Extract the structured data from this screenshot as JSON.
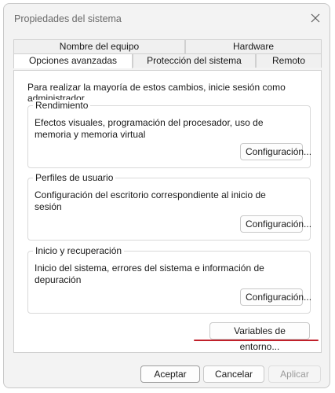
{
  "window": {
    "title": "Propiedades del sistema"
  },
  "tabs": {
    "back_row": [
      "Nombre del equipo",
      "Hardware"
    ],
    "front_row": [
      "Opciones avanzadas",
      "Protección del sistema",
      "Remoto"
    ],
    "active": "Opciones avanzadas"
  },
  "panel": {
    "note": "Para realizar la mayoría de estos cambios, inicie sesión como administrador.",
    "groups": [
      {
        "title": "Rendimiento",
        "description": "Efectos visuales, programación del procesador, uso de memoria y memoria virtual",
        "button": "Configuración..."
      },
      {
        "title": "Perfiles de usuario",
        "description": "Configuración del escritorio correspondiente al inicio de sesión",
        "button": "Configuración..."
      },
      {
        "title": "Inicio y recuperación",
        "description": "Inicio del sistema, errores del sistema e información de depuración",
        "button": "Configuración..."
      }
    ],
    "env_button": "Variables de entorno..."
  },
  "footer": {
    "ok": "Aceptar",
    "cancel": "Cancelar",
    "apply": "Aplicar"
  },
  "colors": {
    "annotation_underline": "#c0202a"
  },
  "icons": {
    "close": "close-icon"
  }
}
